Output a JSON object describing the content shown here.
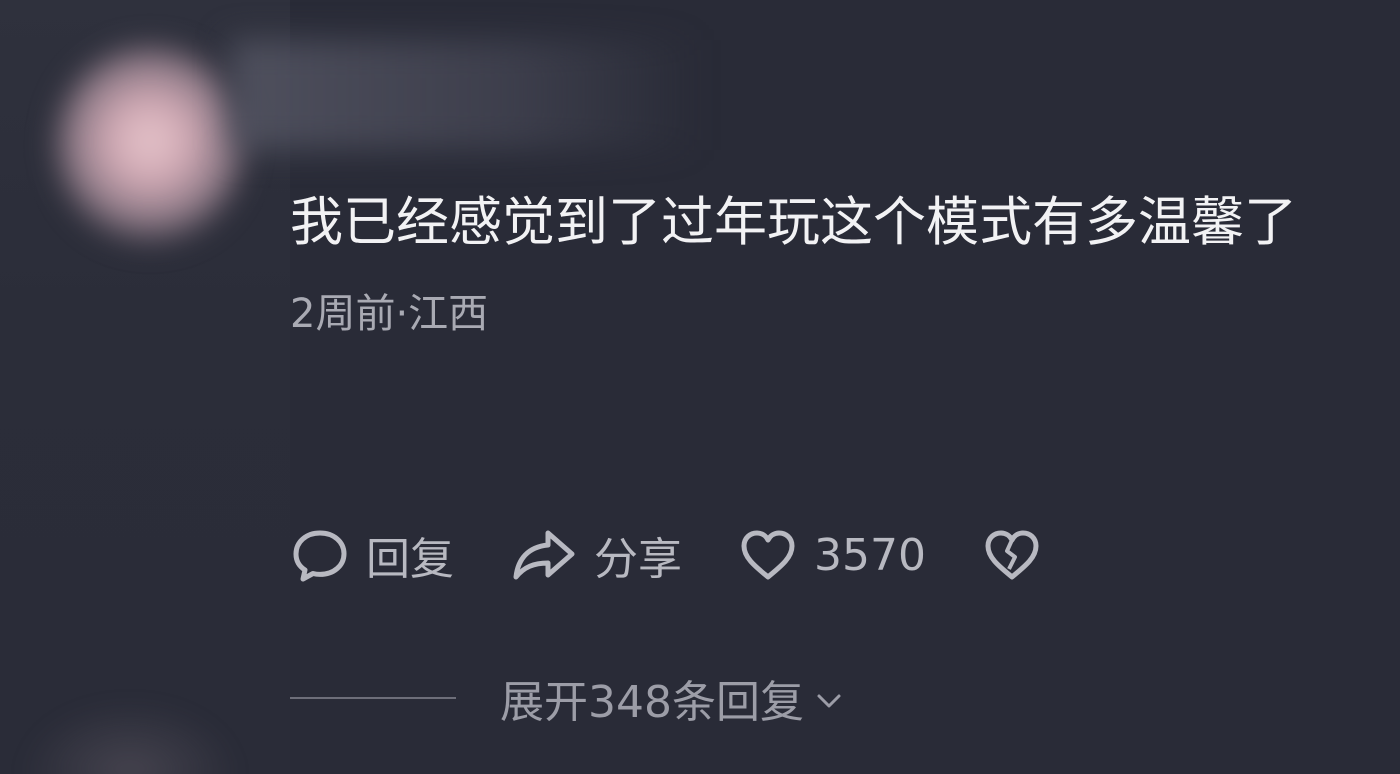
{
  "comment": {
    "text": "我已经感觉到了过年玩这个模式有多温馨了",
    "meta": "2周前·江西"
  },
  "actions": {
    "reply_label": "回复",
    "reply_icon": "comment-bubble-icon",
    "share_label": "分享",
    "share_icon": "share-arrow-icon",
    "like_count": "3570",
    "like_icon": "heart-outline-icon",
    "dislike_icon": "broken-heart-icon"
  },
  "expand": {
    "label": "展开348条回复",
    "icon": "chevron-down-icon"
  },
  "colors": {
    "background": "#292b37",
    "text_primary": "#f2f2f4",
    "text_secondary": "#a9aab3",
    "icon": "#b8b9c1"
  }
}
